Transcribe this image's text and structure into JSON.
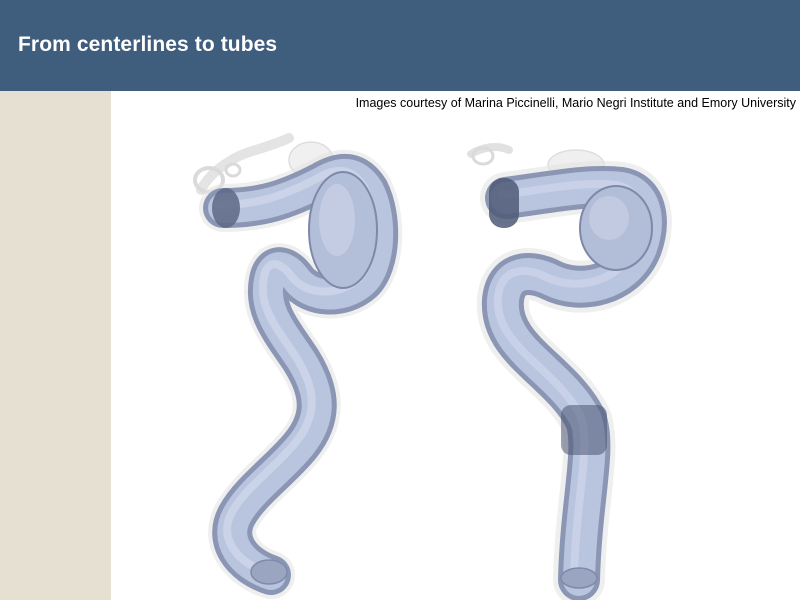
{
  "slide": {
    "title": "From centerlines to tubes",
    "credit": "Images courtesy of Marina Piccinelli, Mario Negri Institute and Emory University"
  },
  "colors": {
    "title_bar": "#3f5d7c",
    "left_band": "#e6e0d2",
    "vessel_fill": "#b7c2dc",
    "vessel_shadow": "#8f9bb8",
    "ghost_surface": "#d9d9d9"
  },
  "figure": {
    "panels": [
      {
        "name": "left-vessel-render"
      },
      {
        "name": "right-vessel-render"
      }
    ]
  }
}
